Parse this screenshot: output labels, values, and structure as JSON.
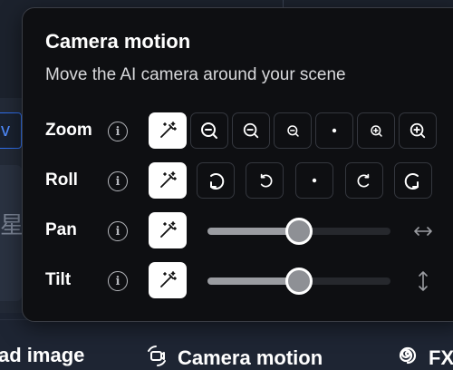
{
  "popover": {
    "title": "Camera motion",
    "subtitle": "Move the AI camera around your scene"
  },
  "rows": {
    "zoom": {
      "label": "Zoom",
      "options": [
        "auto",
        "zoom-out-strong",
        "zoom-out",
        "zoom-out-slight",
        "none",
        "zoom-in-slight",
        "zoom-in"
      ],
      "selected": "auto"
    },
    "roll": {
      "label": "Roll",
      "options": [
        "auto",
        "roll-left-strong",
        "roll-left",
        "none",
        "roll-right",
        "roll-right-strong"
      ],
      "selected": "auto"
    },
    "pan": {
      "label": "Pan",
      "value": 0.5
    },
    "tilt": {
      "label": "Tilt",
      "value": 0.5
    }
  },
  "background": {
    "chip_text": "v",
    "card_text": "星"
  },
  "bottom_bar": {
    "items": [
      {
        "label": "ad image",
        "icon": "none"
      },
      {
        "label": "Camera motion",
        "icon": "camera-motion-icon"
      },
      {
        "label": "FX",
        "icon": "fx-spiral-icon"
      }
    ]
  },
  "colors": {
    "panel_bg": "#0e0f12",
    "accent_selected": "#ffffff",
    "slider_fill": "#9a9ca1"
  }
}
